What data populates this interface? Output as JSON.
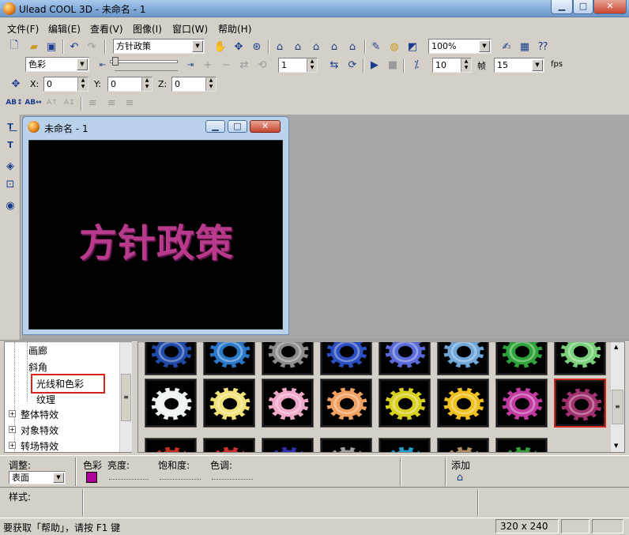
{
  "app": {
    "title": "Ulead COOL 3D - 未命名 - 1",
    "min": "0",
    "max": "1",
    "close": "r"
  },
  "menu": [
    "文件(F)",
    "编辑(E)",
    "查看(V)",
    "图像(I)",
    "窗口(W)",
    "帮助(H)"
  ],
  "toolbar1": {
    "template_select": "方针政策",
    "zoom_select": "100%"
  },
  "toolbar2": {
    "property_select": "色彩",
    "frame_value": "1",
    "frames_value": "10",
    "frame_label": "帧",
    "fps_value": "15",
    "fps_label": "fps"
  },
  "toolbar3": {
    "x_label": "X:",
    "x_value": "0",
    "y_label": "Y:",
    "y_value": "0",
    "z_label": "Z:",
    "z_value": "0"
  },
  "toolbar4": {
    "icons": [
      "AB↕",
      "AB↔",
      "A↑",
      "A↕"
    ]
  },
  "doc": {
    "title": "未命名 - 1",
    "canvas_text": "方针政策",
    "text_color": "#b83a8c"
  },
  "tree": {
    "items": [
      {
        "label": "画廊",
        "level": 2
      },
      {
        "label": "斜角",
        "level": 2
      },
      {
        "label": "光线和色彩",
        "level": 2,
        "highlighted": true
      },
      {
        "label": "纹理",
        "level": 2
      },
      {
        "label": "整体特效",
        "level": 1
      },
      {
        "label": "对象特效",
        "level": 1
      },
      {
        "label": "转场特效",
        "level": 1
      }
    ]
  },
  "gallery": {
    "row0": [
      "#1f4aa8",
      "#2a78c8",
      "#8c8c8c",
      "#2b4fc0",
      "#5a6ad8",
      "#6fa7d8",
      "#2ea33a",
      "#7ad07a"
    ],
    "row1": [
      "#eef2f0",
      "#f2e27a",
      "#f0a8c8",
      "#f0a060",
      "#d8d020",
      "#f0c020",
      "#c03aa0",
      "#a0306e"
    ],
    "row2": [
      "#c83020",
      "#d03030",
      "#3030b0",
      "#a0a0a0",
      "#20a0d0",
      "#b09060",
      "#30a040"
    ],
    "selected_index": 15
  },
  "bottom": {
    "adjust_label": "调整:",
    "adjust_value": "表面",
    "color_label": "色彩",
    "color_value": "#b0009a",
    "brightness_label": "亮度:",
    "saturation_label": "饱和度:",
    "hue_label": "色调:",
    "add_label": "添加",
    "style_label": "样式:"
  },
  "status": {
    "help_text": "要获取「帮助」，请按 F1 键",
    "size": "320 x 240"
  }
}
